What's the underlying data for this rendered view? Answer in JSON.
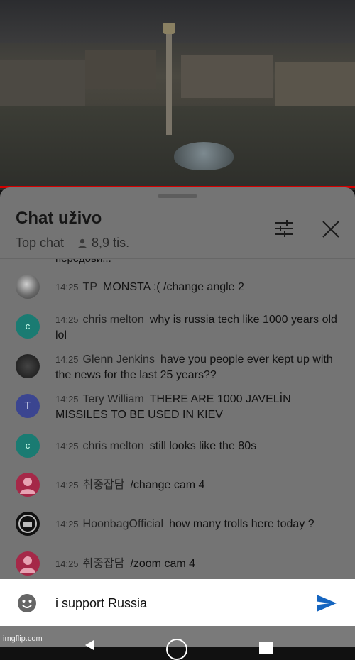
{
  "video": {
    "description_icon": "video-thumbnail"
  },
  "chat": {
    "title": "Chat uživo",
    "mode_label": "Top chat",
    "viewers": "8,9 tis.",
    "cut_text": "передови..."
  },
  "messages": [
    {
      "time": "14:25",
      "author": "TP",
      "text": "MONSTA :(   /change angle 2",
      "avatar": "photo"
    },
    {
      "time": "14:25",
      "author": "chris melton",
      "text": "why is russia tech like 1000 years old lol",
      "avatar": "teal",
      "initial": "c"
    },
    {
      "time": "14:25",
      "author": "Glenn Jenkins",
      "text": "have you people ever kept up with the news for the last 25 years??",
      "avatar": "dark"
    },
    {
      "time": "14:25",
      "author": "Tery William",
      "text": "THERE ARE 1000 JAVELİN MISSILES TO BE USED IN KIEV",
      "avatar": "purple",
      "initial": "T"
    },
    {
      "time": "14:25",
      "author": "chris melton",
      "text": "still looks like the 80s",
      "avatar": "teal",
      "initial": "c"
    },
    {
      "time": "14:25",
      "author": "취중잡담",
      "text": "/change cam 4",
      "avatar": "pink"
    },
    {
      "time": "14:25",
      "author": "HoonbagOfficial",
      "text": "how many trolls here today ?",
      "avatar": "black"
    },
    {
      "time": "14:25",
      "author": "취중잡담",
      "text": "/zoom cam 4",
      "avatar": "pink"
    }
  ],
  "input": {
    "value": "i support Russia"
  },
  "watermark": "imgflip.com",
  "colors": {
    "accent": "#1565c0",
    "red_bar": "#d40000"
  }
}
